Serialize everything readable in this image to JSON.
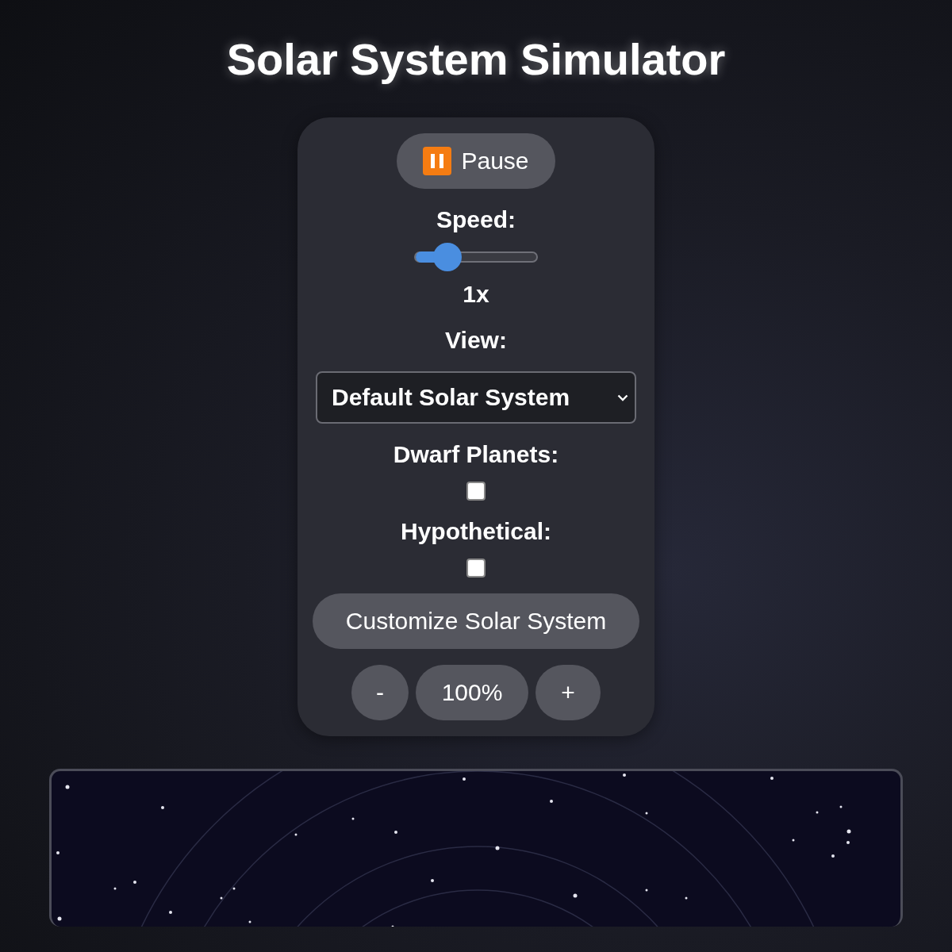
{
  "title": "Solar System Simulator",
  "controls": {
    "pause_button": {
      "label": "Pause"
    },
    "speed": {
      "label": "Speed:",
      "level": 0.2,
      "reading": "1x"
    },
    "view": {
      "label": "View:",
      "value": "Default Solar System"
    },
    "options": [
      {
        "label": "Dwarf Planets:",
        "checked": false
      },
      {
        "label": "Hypothetical:",
        "checked": false
      }
    ],
    "customize_button": {
      "label": "Customize Solar System"
    },
    "zoom": {
      "minus": "-",
      "reading": "100%",
      "plus": "+"
    }
  }
}
